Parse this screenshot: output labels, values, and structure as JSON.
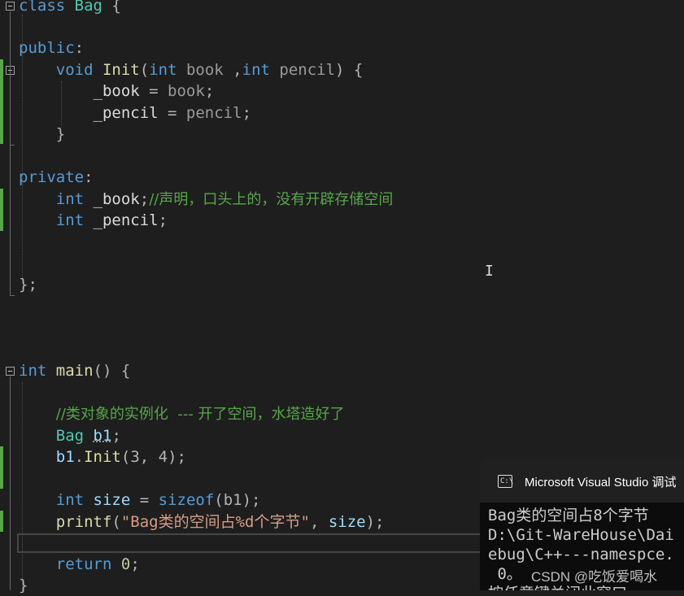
{
  "editor": {
    "lines": {
      "l1": {
        "kw": "class",
        "name": "Bag",
        "rest": " {"
      },
      "l2": {
        "kw": "public",
        "rest": ":"
      },
      "l3": {
        "ret": "void",
        "name": "Init",
        "p1": "(",
        "t1": "int",
        "a1": " book ",
        "c1": ",",
        "t2": "int",
        "a2": " pencil",
        "end": ") {"
      },
      "l4": {
        "field": "_book",
        "op": " = ",
        "val": "book",
        "end": ";"
      },
      "l5": {
        "field": "_pencil",
        "op": " = ",
        "val": "pencil",
        "end": ";"
      },
      "l6": {
        "text": "}"
      },
      "l7": {
        "kw": "private",
        "rest": ":"
      },
      "l8": {
        "type": "int",
        "field": " _book",
        "end": ";",
        "comment": "//声明，口头上的，没有开辟存储空间"
      },
      "l9": {
        "type": "int",
        "field": " _pencil",
        "end": ";"
      },
      "l10": {
        "text": "};"
      },
      "l11": {
        "type": "int",
        "name": "main",
        "rest": "() {"
      },
      "l12": {
        "comment": "//类对象的实例化  --- 开了空间，水塔造好了"
      },
      "l13": {
        "cls": "Bag",
        "var": "b1",
        "end": ";"
      },
      "l14": {
        "var": "b1",
        "dot": ".",
        "fn": "Init",
        "args": "(3, 4);"
      },
      "l15": {
        "type": "int",
        "var": "size",
        "op": " = ",
        "fn": "sizeof",
        "args": "(b1);"
      },
      "l16": {
        "fn": "printf",
        "p": "(",
        "str": "\"Bag类的空间占%d个字节\"",
        "sep": ", ",
        "var": "size",
        "end": ");"
      },
      "l17": {
        "kw": "return",
        "num": "0",
        "end": ";"
      },
      "l18": {
        "text": "}"
      }
    }
  },
  "console": {
    "icon": "C:\\",
    "title": "Microsoft Visual Studio 调试",
    "lines": [
      "Bag类的空间占8个字节",
      "D:\\Git-WareHouse\\Dai",
      "ebug\\C++---namespce.",
      " 0。",
      "按任意键关闭此窗口"
    ],
    "watermark": "CSDN @吃饭爱喝水"
  }
}
